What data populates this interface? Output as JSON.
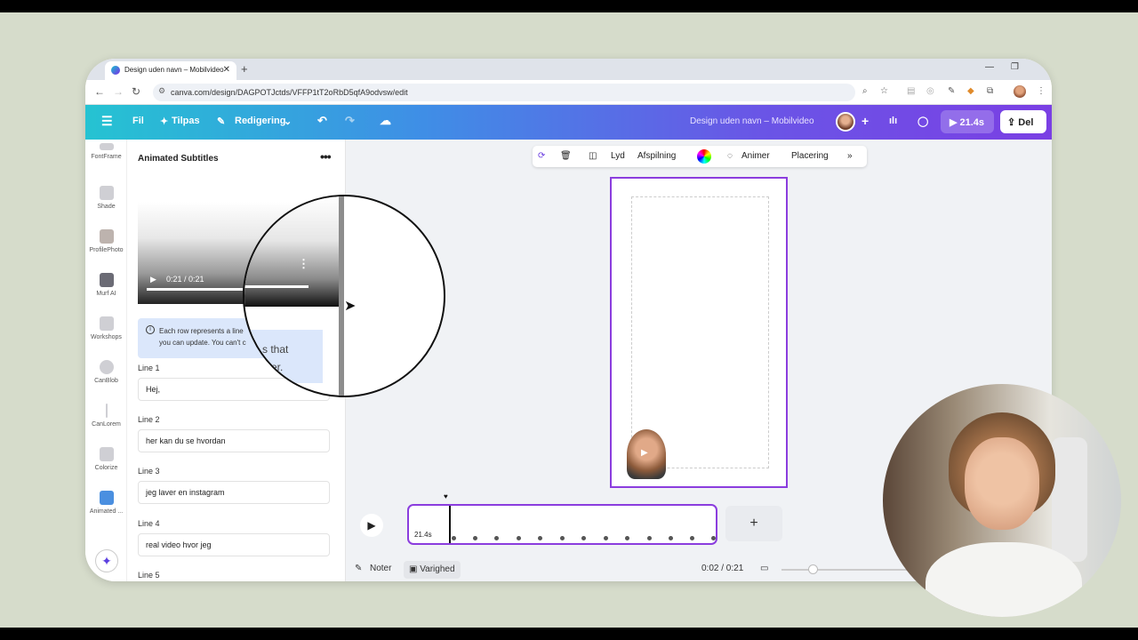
{
  "browser": {
    "tab_title": "Design uden navn – Mobilvideo",
    "url": "canva.com/design/DAGPOTJctds/VFFP1tT2oRbD5qfA9odvsw/edit"
  },
  "toolbar": {
    "file": "Fil",
    "resize": "Tilpas",
    "editing": "Redigering",
    "doc_title": "Design uden navn – Mobilvideo",
    "duration": "21.4s",
    "share": "Del"
  },
  "sidebar": {
    "items": [
      {
        "label": "FontFrame"
      },
      {
        "label": "Shade"
      },
      {
        "label": "ProfilePhoto"
      },
      {
        "label": "Murf AI"
      },
      {
        "label": "Workshops"
      },
      {
        "label": "CanBlob"
      },
      {
        "label": "CanLorem"
      },
      {
        "label": "Colorize"
      },
      {
        "label": "Animated ..."
      }
    ]
  },
  "panel": {
    "title": "Animated Subtitles",
    "video_time": "0:21 / 0:21",
    "info_text_1": "Each row represents a line",
    "info_text_2": "you can update. You can't c",
    "magnified_1": "s that",
    "magnified_2": "ater.",
    "lines": [
      {
        "label": "Line 1",
        "value": "Hej,"
      },
      {
        "label": "Line 2",
        "value": "her kan du se hvordan"
      },
      {
        "label": "Line 3",
        "value": "jeg laver en instagram"
      },
      {
        "label": "Line 4",
        "value": "real video hvor jeg"
      },
      {
        "label": "Line 5",
        "value": ""
      }
    ]
  },
  "context_bar": {
    "audio": "Lyd",
    "playback": "Afspilning",
    "animate": "Animer",
    "position": "Placering"
  },
  "timeline": {
    "clip_duration": "21.4s",
    "current_time": "0:02 / 0:21",
    "notes": "Noter",
    "duration_label": "Varighed",
    "progress": 0.1
  },
  "colors": {
    "accent": "#8b3dde",
    "toolbar_start": "#25c3d2",
    "toolbar_end": "#7a3fe4"
  }
}
